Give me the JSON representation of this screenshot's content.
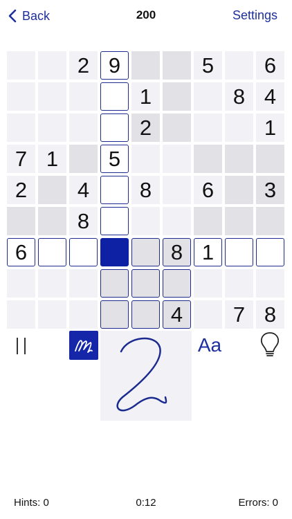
{
  "header": {
    "back_label": "Back",
    "title": "200",
    "settings_label": "Settings"
  },
  "grid": [
    [
      "l",
      "l",
      "l:2",
      "o:9",
      "d",
      "d",
      "l:5",
      "l",
      "l:6"
    ],
    [
      "l",
      "l",
      "l",
      "o",
      "l:1",
      "d",
      "l",
      "l:8",
      "l:4"
    ],
    [
      "l",
      "l",
      "l",
      "o",
      "d:2",
      "d",
      "l",
      "l",
      "l:1"
    ],
    [
      "l:7",
      "l:1",
      "d",
      "o:5",
      "l",
      "l",
      "d",
      "d",
      "d"
    ],
    [
      "l:2",
      "d",
      "l:4",
      "o",
      "l:8",
      "l",
      "l:6",
      "d",
      "d:3"
    ],
    [
      "d",
      "d",
      "l:8",
      "o",
      "l",
      "l",
      "d",
      "d",
      "d"
    ],
    [
      "o:6",
      "o",
      "o",
      "s",
      "od",
      "od:8",
      "o:1",
      "o",
      "o"
    ],
    [
      "l",
      "l",
      "l",
      "od",
      "od",
      "od",
      "l",
      "l",
      "l"
    ],
    [
      "l",
      "l",
      "l",
      "od",
      "od",
      "od:4",
      "l",
      "l:7",
      "l:8"
    ]
  ],
  "tools": {
    "pause_icon": "pause-icon",
    "pencil_icon": "pencil-scribble-icon",
    "font_label": "Aa",
    "hint_icon": "lightbulb-icon"
  },
  "handwriting": {
    "recognized_digit": "2"
  },
  "footer": {
    "hints": "Hints: 0",
    "timer": "0:12",
    "errors": "Errors: 0"
  },
  "colors": {
    "accent": "#1d2f9e",
    "selected": "#0e21a5",
    "light_cell": "#f2f2f6",
    "dark_cell": "#e1e1e6"
  }
}
